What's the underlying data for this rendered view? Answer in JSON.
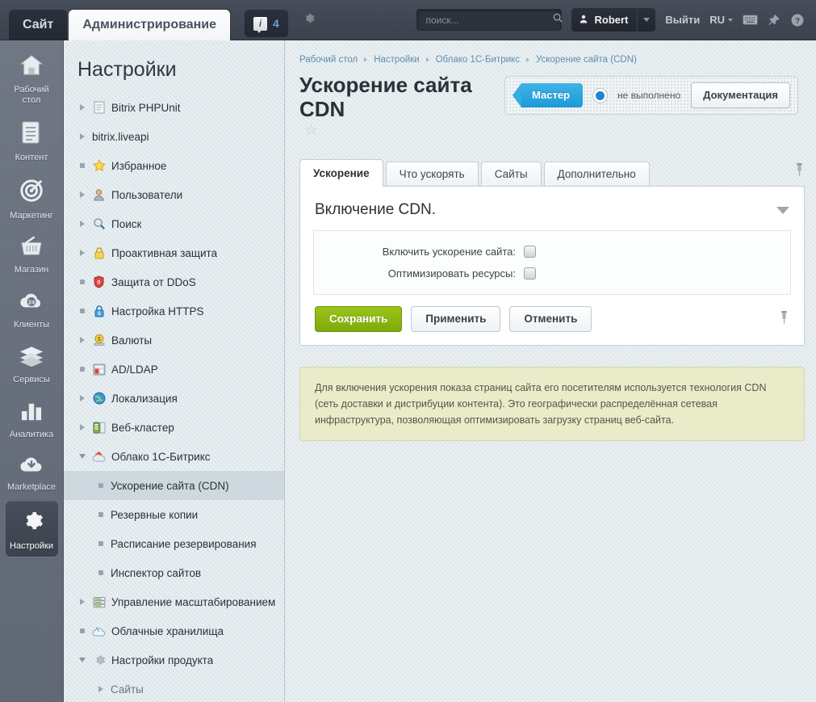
{
  "topbar": {
    "tabs": [
      {
        "label": "Сайт",
        "active": false
      },
      {
        "label": "Администрирование",
        "active": true
      }
    ],
    "notifications_count": "4",
    "search_placeholder": "поиск...",
    "search_value": "",
    "user_name": "Robert",
    "logout_label": "Выйти",
    "language_label": "RU"
  },
  "rail": {
    "items": [
      {
        "label": "Рабочий стол",
        "icon": "home-icon",
        "active": false
      },
      {
        "label": "Контент",
        "icon": "document-icon",
        "active": false
      },
      {
        "label": "Маркетинг",
        "icon": "target-icon",
        "active": false
      },
      {
        "label": "Магазин",
        "icon": "basket-icon",
        "active": false
      },
      {
        "label": "Клиенты",
        "icon": "support24-icon",
        "active": false
      },
      {
        "label": "Сервисы",
        "icon": "layers-icon",
        "active": false
      },
      {
        "label": "Аналитика",
        "icon": "bar-chart-icon",
        "active": false
      },
      {
        "label": "Marketplace",
        "icon": "cloud-download-icon",
        "active": false
      },
      {
        "label": "Настройки",
        "icon": "gear-icon",
        "active": true
      }
    ]
  },
  "tree": {
    "title": "Настройки",
    "items": [
      {
        "label": "Bitrix PHPUnit",
        "marker": "arrow-r",
        "icon": "page-icon",
        "level": 1,
        "selected": false
      },
      {
        "label": "bitrix.liveapi",
        "marker": "arrow-r",
        "icon": "none",
        "level": 1,
        "selected": false
      },
      {
        "label": "Избранное",
        "marker": "dot",
        "icon": "star-icon",
        "level": 1,
        "selected": false
      },
      {
        "label": "Пользователи",
        "marker": "arrow-r",
        "icon": "user-icon",
        "level": 1,
        "selected": false
      },
      {
        "label": "Поиск",
        "marker": "arrow-r",
        "icon": "magnifier-icon",
        "level": 1,
        "selected": false
      },
      {
        "label": "Проактивная защита",
        "marker": "arrow-r",
        "icon": "lock-icon",
        "level": 1,
        "selected": false
      },
      {
        "label": "Защита от DDoS",
        "marker": "dot",
        "icon": "shield-icon",
        "level": 1,
        "selected": false
      },
      {
        "label": "Настройка HTTPS",
        "marker": "dot",
        "icon": "https-lock-icon",
        "level": 1,
        "selected": false
      },
      {
        "label": "Валюты",
        "marker": "arrow-r",
        "icon": "coin-icon",
        "level": 1,
        "selected": false
      },
      {
        "label": "AD/LDAP",
        "marker": "dot",
        "icon": "directory-icon",
        "level": 1,
        "selected": false
      },
      {
        "label": "Локализация",
        "marker": "arrow-r",
        "icon": "globe-icon",
        "level": 1,
        "selected": false
      },
      {
        "label": "Веб-кластер",
        "marker": "arrow-r",
        "icon": "server-icon",
        "level": 1,
        "selected": false
      },
      {
        "label": "Облако 1С-Битрикс",
        "marker": "arrow-d",
        "icon": "cloud-icon",
        "level": 1,
        "selected": false
      },
      {
        "label": "Ускорение сайта (CDN)",
        "marker": "dot",
        "icon": "none",
        "level": 2,
        "selected": true
      },
      {
        "label": "Резервные копии",
        "marker": "dot",
        "icon": "none",
        "level": 2,
        "selected": false
      },
      {
        "label": "Расписание резервирования",
        "marker": "dot",
        "icon": "none",
        "level": 2,
        "selected": false
      },
      {
        "label": "Инспектор сайтов",
        "marker": "dot",
        "icon": "none",
        "level": 2,
        "selected": false
      },
      {
        "label": "Управление масштабированием",
        "marker": "arrow-r",
        "icon": "rack-icon",
        "level": 1,
        "selected": false
      },
      {
        "label": "Облачные хранилища",
        "marker": "dot",
        "icon": "cloud-storage-icon",
        "level": 1,
        "selected": false
      },
      {
        "label": "Настройки продукта",
        "marker": "arrow-d",
        "icon": "gear-small-icon",
        "level": 1,
        "selected": false
      },
      {
        "label": "Сайты",
        "marker": "arrow-r",
        "icon": "none",
        "level": 2,
        "selected": false,
        "dim": true
      }
    ]
  },
  "main": {
    "breadcrumbs": [
      "Рабочий стол",
      "Настройки",
      "Облако 1С-Битрикс",
      "Ускорение сайта (CDN)"
    ],
    "page_title": "Ускорение сайта CDN",
    "wizard_button": "Мастер",
    "status_text": "не выполнено",
    "documentation_button": "Документация",
    "tabs": [
      {
        "label": "Ускорение",
        "active": true
      },
      {
        "label": "Что ускорять",
        "active": false
      },
      {
        "label": "Сайты",
        "active": false
      },
      {
        "label": "Дополнительно",
        "active": false
      }
    ],
    "section_title": "Включение CDN.",
    "fields": [
      {
        "label": "Включить ускорение сайта:",
        "checked": false
      },
      {
        "label": "Оптимизировать ресурсы:",
        "checked": false
      }
    ],
    "buttons": {
      "save": "Сохранить",
      "apply": "Применить",
      "cancel": "Отменить"
    },
    "note": "Для включения ускорения показа страниц сайта его посетителям используется технология CDN (сеть доставки и дистрибуции контента). Это географически распределённая сетевая инфраструктура, позволяющая оптимизировать загрузку страниц веб-сайта."
  },
  "colors": {
    "accent_blue": "#1e9ad6",
    "save_green": "#8fb812",
    "note_bg": "#eaecc9",
    "page_bg": "#e2eaed",
    "topbar_bg": "#3b424e"
  }
}
